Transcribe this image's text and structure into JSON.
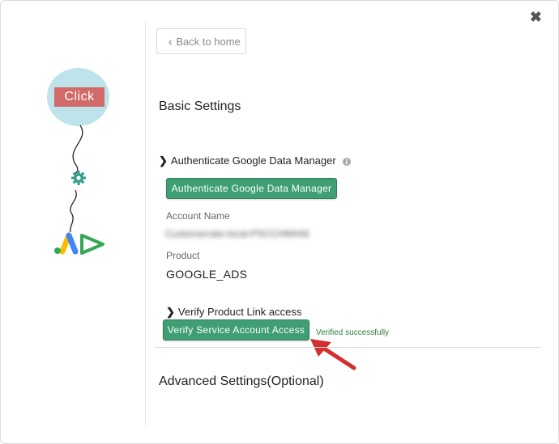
{
  "modal": {
    "close_glyph": "✖"
  },
  "illustration": {
    "click_label": "Click",
    "bubble_color": "#bfe3ea",
    "click_color": "#d26a6a",
    "icons": [
      "gear-icon",
      "google-ads-logo"
    ]
  },
  "nav": {
    "back_label": "Back to home",
    "back_icon": "chevron-left-icon"
  },
  "basic": {
    "title": "Basic Settings",
    "auth_heading": "Authenticate Google Data Manager",
    "info_glyph": "i",
    "auth_button": "Authenticate Google Data Manager",
    "account_name_label": "Account Name",
    "account_name_value": "Customerrate-local-PSCCHM#All",
    "product_label": "Product",
    "product_value": "GOOGLE_ADS",
    "verify_heading": "Verify Product Link access",
    "verify_button": "Verify Service Account Access",
    "verified_text": "Verified successfully"
  },
  "advanced": {
    "title": "Advanced Settings(Optional)"
  },
  "colors": {
    "accent_green": "#3f9e74",
    "success_text": "#2e7d3a",
    "annotation_arrow": "#d32f2f"
  }
}
